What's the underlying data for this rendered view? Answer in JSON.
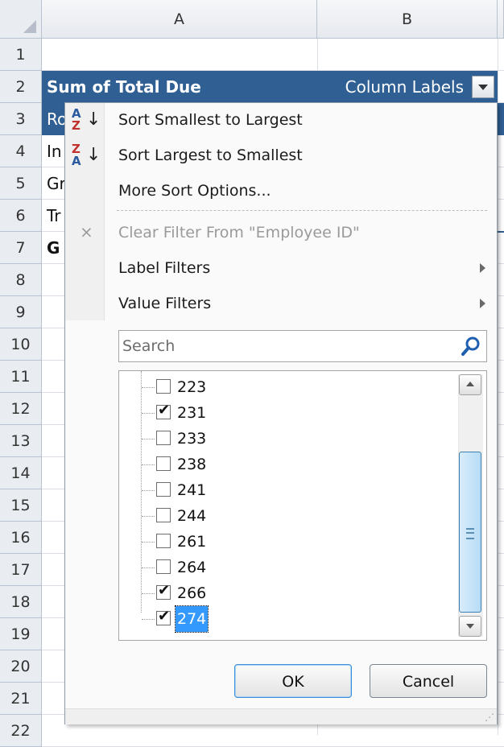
{
  "sheet": {
    "columns": [
      "A",
      "B"
    ],
    "rows": [
      "1",
      "2",
      "3",
      "4",
      "5",
      "6",
      "7",
      "8",
      "9",
      "10",
      "11",
      "12",
      "13",
      "14",
      "15",
      "16",
      "17",
      "18",
      "19",
      "20",
      "21",
      "22"
    ],
    "pivot_title": "Sum of Total Due",
    "column_labels": "Column Labels",
    "row3": "Ro",
    "row4": "In",
    "row5": "Gr",
    "row6": "Tr",
    "row7": "G"
  },
  "menu": {
    "sort_asc": "Sort Smallest to Largest",
    "sort_desc": "Sort Largest to Smallest",
    "more_sort": "More Sort Options...",
    "clear_filter": "Clear Filter From \"Employee ID\"",
    "label_filters": "Label Filters",
    "value_filters": "Value Filters",
    "sort_asc_icon": [
      "A",
      "Z"
    ],
    "sort_desc_icon": [
      "Z",
      "A"
    ]
  },
  "search": {
    "placeholder": "Search"
  },
  "list": {
    "items": [
      {
        "label": "223",
        "checked": false
      },
      {
        "label": "231",
        "checked": true
      },
      {
        "label": "233",
        "checked": false
      },
      {
        "label": "238",
        "checked": false
      },
      {
        "label": "241",
        "checked": false
      },
      {
        "label": "244",
        "checked": false
      },
      {
        "label": "261",
        "checked": false
      },
      {
        "label": "264",
        "checked": false
      },
      {
        "label": "266",
        "checked": true
      },
      {
        "label": "274",
        "checked": true,
        "selected": true
      }
    ]
  },
  "buttons": {
    "ok": "OK",
    "cancel": "Cancel"
  },
  "colors": {
    "pivot_header": "#2f5f93",
    "selection": "#3399ff",
    "ok_border": "#3c8ed6"
  }
}
